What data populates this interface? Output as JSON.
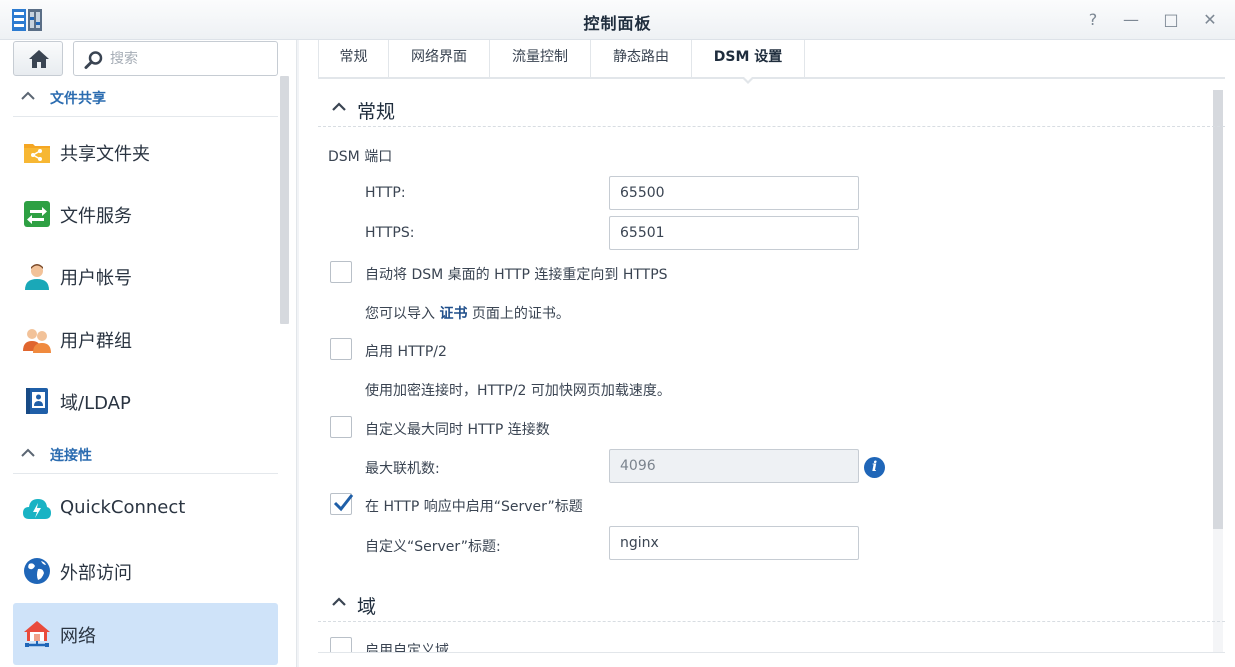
{
  "window": {
    "title": "控制面板",
    "help_glyph": "?",
    "min_glyph": "—",
    "max_glyph": "□",
    "close_glyph": "✕"
  },
  "sidebar": {
    "search_placeholder": "搜索",
    "sections": [
      {
        "label": "文件共享"
      },
      {
        "label": "连接性"
      }
    ],
    "items": [
      {
        "label": "共享文件夹",
        "icon": "shared-folder-icon"
      },
      {
        "label": "文件服务",
        "icon": "file-services-icon"
      },
      {
        "label": "用户帐号",
        "icon": "user-icon"
      },
      {
        "label": "用户群组",
        "icon": "group-icon"
      },
      {
        "label": "域/LDAP",
        "icon": "domain-ldap-icon"
      },
      {
        "label": "QuickConnect",
        "icon": "quickconnect-icon"
      },
      {
        "label": "外部访问",
        "icon": "globe-icon"
      },
      {
        "label": "网络",
        "icon": "network-house-icon",
        "active": true
      }
    ]
  },
  "tabs": [
    {
      "label": "常规"
    },
    {
      "label": "网络界面"
    },
    {
      "label": "流量控制"
    },
    {
      "label": "静态路由"
    },
    {
      "label": "DSM 设置",
      "active": true
    }
  ],
  "general": {
    "title": "常规",
    "dsm_port_label": "DSM 端口",
    "http_label": "HTTP:",
    "http_value": "65500",
    "https_label": "HTTPS:",
    "https_value": "65501",
    "redirect_label": "自动将 DSM 桌面的 HTTP 连接重定向到 HTTPS",
    "redirect_checked": false,
    "cert_note_pre": "您可以导入 ",
    "cert_note_link": "证书",
    "cert_note_post": " 页面上的证书。",
    "http2_label": "启用 HTTP/2",
    "http2_checked": false,
    "http2_note": "使用加密连接时，HTTP/2 可加快网页加载速度。",
    "max_conn_label": "自定义最大同时 HTTP 连接数",
    "max_conn_checked": false,
    "max_conn_field_label": "最大联机数:",
    "max_conn_value": "4096",
    "server_header_label": "在 HTTP 响应中启用“Server”标题",
    "server_header_checked": true,
    "custom_server_label": "自定义“Server”标题:",
    "custom_server_value": "nginx"
  },
  "domain": {
    "title": "域",
    "custom_domain_label": "启用自定义域"
  },
  "colors": {
    "accent": "#2b6cb0",
    "active_bg": "#cfe3f9",
    "link": "#1f4e8a"
  }
}
